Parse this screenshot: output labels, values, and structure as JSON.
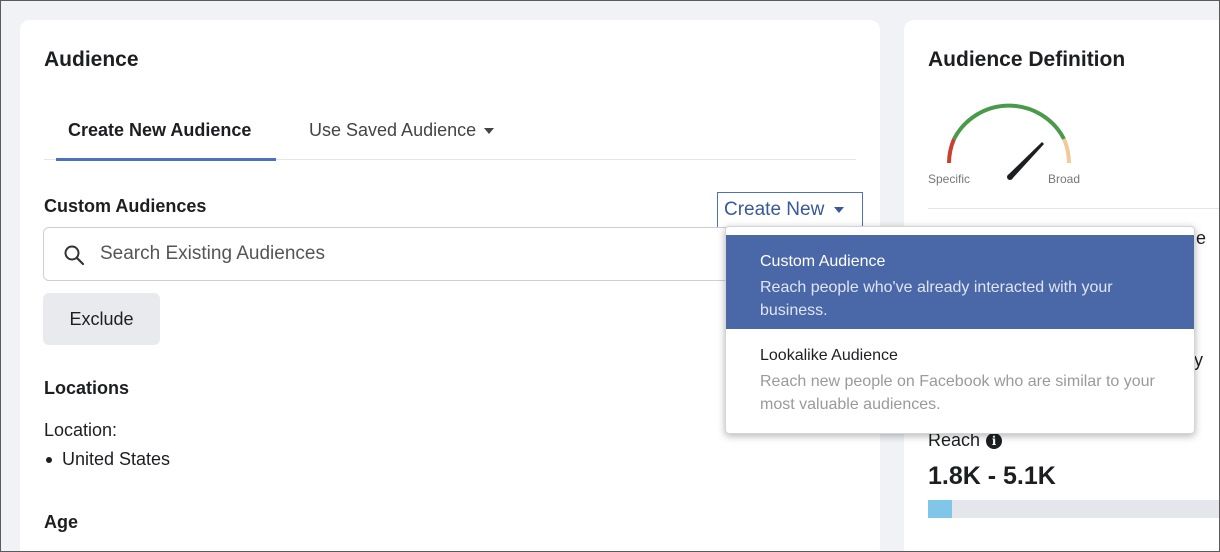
{
  "audience_card": {
    "title": "Audience",
    "tabs": [
      {
        "label": "Create New Audience",
        "active": true
      },
      {
        "label": "Use Saved Audience",
        "active": false
      }
    ],
    "custom_audiences": {
      "label": "Custom Audiences",
      "create_new_label": "Create New",
      "search_placeholder": "Search Existing Audiences",
      "exclude_label": "Exclude"
    },
    "locations": {
      "label": "Locations",
      "location_label": "Location:",
      "items": [
        "United States"
      ]
    },
    "age": {
      "label": "Age"
    }
  },
  "definition_card": {
    "title": "Audience Definition",
    "gauge": {
      "left_label": "Specific",
      "right_label": "Broad"
    },
    "partial_text_1": "le",
    "partial_text_2": "y",
    "reach": {
      "label": "Reach",
      "value": "1.8K - 5.1K",
      "fill_fraction": 0.08
    }
  },
  "dropdown": {
    "items": [
      {
        "title": "Custom Audience",
        "description": "Reach people who've already interacted with your business.",
        "selected": true
      },
      {
        "title": "Lookalike Audience",
        "description": "Reach new people on Facebook who are similar to your most valuable audiences.",
        "selected": false
      }
    ]
  },
  "colors": {
    "accent": "#4a72c0",
    "dropdown_selected": "#4a67a8",
    "reach_fill": "#7fc6e8"
  }
}
